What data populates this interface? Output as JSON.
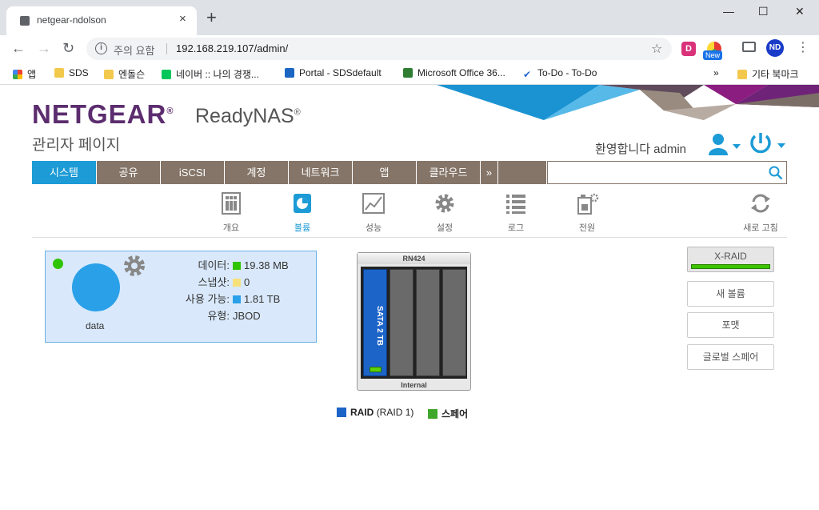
{
  "browser": {
    "tab_title": "netgear-ndolson",
    "tab_close": "×",
    "new_tab": "+",
    "security_label": "주의 요함",
    "url": "192.168.219.107/admin/",
    "ext_badge": "New",
    "ext_d_letter": "D",
    "profile_initials": "ND",
    "bookmarks": [
      {
        "label": "앱"
      },
      {
        "label": "SDS"
      },
      {
        "label": "엔돌슨"
      },
      {
        "label": "네이버 :: 나의 경쟁..."
      },
      {
        "label": "Portal - SDSdefault"
      },
      {
        "label": "Microsoft Office 36..."
      },
      {
        "label": "To-Do - To-Do"
      }
    ],
    "bookmarks_more": "»",
    "bookmarks_other": "기타 북마크"
  },
  "header": {
    "brand": "NETGEAR",
    "product": "ReadyNAS",
    "subtitle": "관리자 페이지",
    "welcome": "환영합니다 admin"
  },
  "menu": {
    "items": [
      "시스템",
      "공유",
      "iSCSI",
      "계정",
      "네트워크",
      "앱",
      "클라우드"
    ],
    "more": "»",
    "active": "시스템"
  },
  "subnav": {
    "items": [
      {
        "label": "개요",
        "icon": "overview-icon"
      },
      {
        "label": "볼륨",
        "icon": "volume-icon"
      },
      {
        "label": "성능",
        "icon": "performance-icon"
      },
      {
        "label": "설정",
        "icon": "settings-icon"
      },
      {
        "label": "로그",
        "icon": "logs-icon"
      },
      {
        "label": "전원",
        "icon": "power-icon"
      },
      {
        "label": "새로 고침",
        "icon": "refresh-icon"
      }
    ],
    "active": "볼륨"
  },
  "volume": {
    "name": "data",
    "rows": [
      {
        "key": "데이터:",
        "value": "19.38 MB",
        "color": "#2ec400"
      },
      {
        "key": "스냅샷:",
        "value": "0",
        "color": "#f6e07a"
      },
      {
        "key": "사용 가능:",
        "value": "1.81 TB",
        "color": "#2aa0e8"
      },
      {
        "key": "유형:",
        "value": "JBOD",
        "color": ""
      }
    ]
  },
  "chassis": {
    "model": "RN424",
    "location": "Internal",
    "bay1_label": "SATA 2 TB"
  },
  "legend": {
    "raid_label": "RAID",
    "raid_type": "(RAID 1)",
    "spare_label": "스페어"
  },
  "actions": {
    "xraid": "X-RAID",
    "new_volume": "새 볼륨",
    "format": "포맷",
    "global_spare": "글로벌 스페어"
  }
}
